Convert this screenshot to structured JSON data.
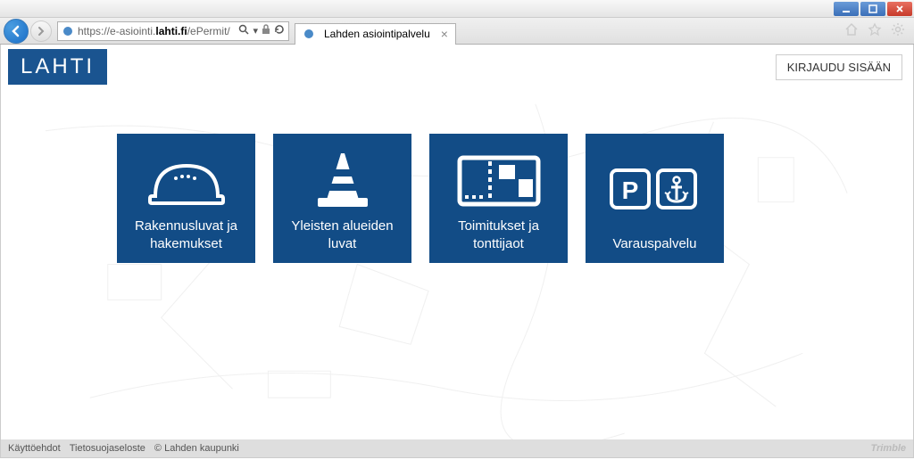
{
  "window": {
    "min_tooltip": "Minimize",
    "max_tooltip": "Maximize",
    "close_tooltip": "Close"
  },
  "browser": {
    "url_prefix": "https://e-asiointi.",
    "url_host": "lahti.fi",
    "url_path": "/ePermit/",
    "tab_title": "Lahden asiointipalvelu"
  },
  "header": {
    "logo_text": "LAHTI",
    "login_label": "KIRJAUDU SISÄÄN"
  },
  "tiles": [
    {
      "label": "Rakennusluvat ja hakemukset"
    },
    {
      "label": "Yleisten alueiden luvat"
    },
    {
      "label": "Toimitukset ja tonttijaot"
    },
    {
      "label": "Varauspalvelu"
    }
  ],
  "footer": {
    "terms": "Käyttöehdot",
    "privacy": "Tietosuojaseloste",
    "copyright": "© Lahden kaupunki",
    "brand": "Trimble"
  }
}
